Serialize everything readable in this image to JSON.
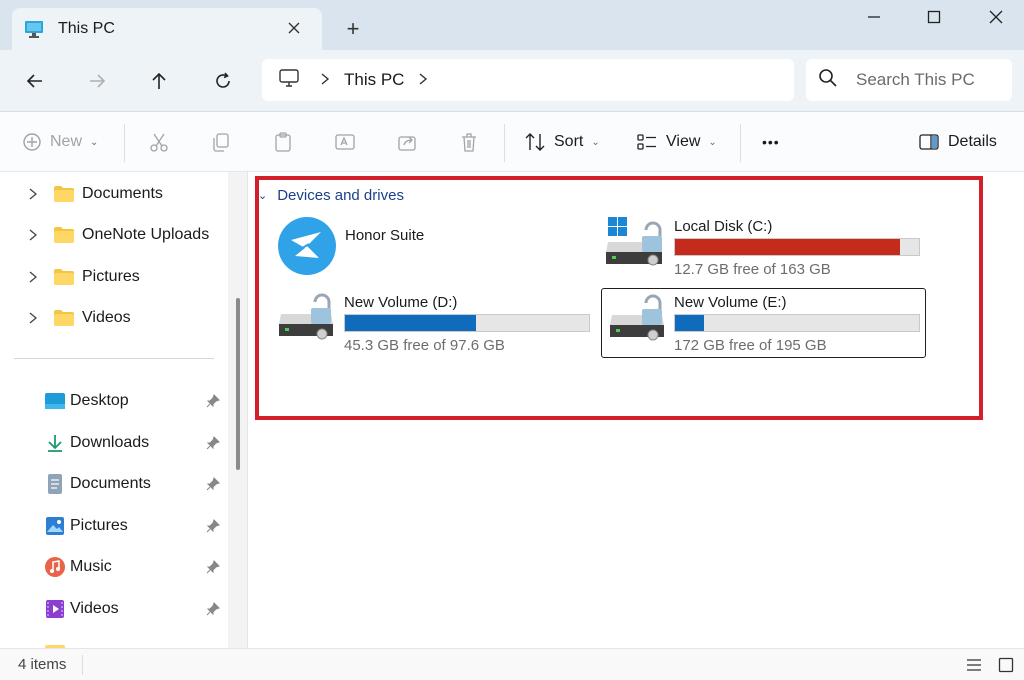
{
  "window": {
    "tab_title": "This PC",
    "new_tab_symbol": "+"
  },
  "address": {
    "segments": [
      "This PC"
    ],
    "search_placeholder": "Search This PC"
  },
  "commands": {
    "new_label": "New",
    "sort_label": "Sort",
    "view_label": "View",
    "more_label": "•••",
    "details_label": "Details"
  },
  "sidebar": {
    "folders": [
      {
        "label": "Documents"
      },
      {
        "label": "OneNote Uploads"
      },
      {
        "label": "Pictures"
      },
      {
        "label": "Videos"
      }
    ],
    "quick_access": [
      {
        "label": "Desktop",
        "icon": "desktop-icon"
      },
      {
        "label": "Downloads",
        "icon": "downloads-icon"
      },
      {
        "label": "Documents",
        "icon": "documents-icon"
      },
      {
        "label": "Pictures",
        "icon": "pictures-icon"
      },
      {
        "label": "Music",
        "icon": "music-icon"
      },
      {
        "label": "Videos",
        "icon": "videos-icon"
      }
    ]
  },
  "group": {
    "title": "Devices and drives"
  },
  "drives": [
    {
      "name": "Honor Suite",
      "icon": "honor-suite-icon"
    },
    {
      "name": "Local Disk (C:)",
      "free_text": "12.7 GB free of 163 GB",
      "used_fraction": 0.922,
      "bar_color": "#c42b1c",
      "icon": "windows-drive-icon"
    },
    {
      "name": "New Volume (D:)",
      "free_text": "45.3 GB free of 97.6 GB",
      "used_fraction": 0.536,
      "bar_color": "#0f6cbd",
      "icon": "drive-icon"
    },
    {
      "name": "New Volume (E:)",
      "free_text": "172 GB free of 195 GB",
      "used_fraction": 0.118,
      "bar_color": "#0f6cbd",
      "icon": "drive-icon"
    }
  ],
  "status": {
    "item_count": "4 items"
  },
  "colors": {
    "highlight": "#d2202b",
    "accent": "#0f6cbd",
    "warning": "#c42b1c"
  }
}
